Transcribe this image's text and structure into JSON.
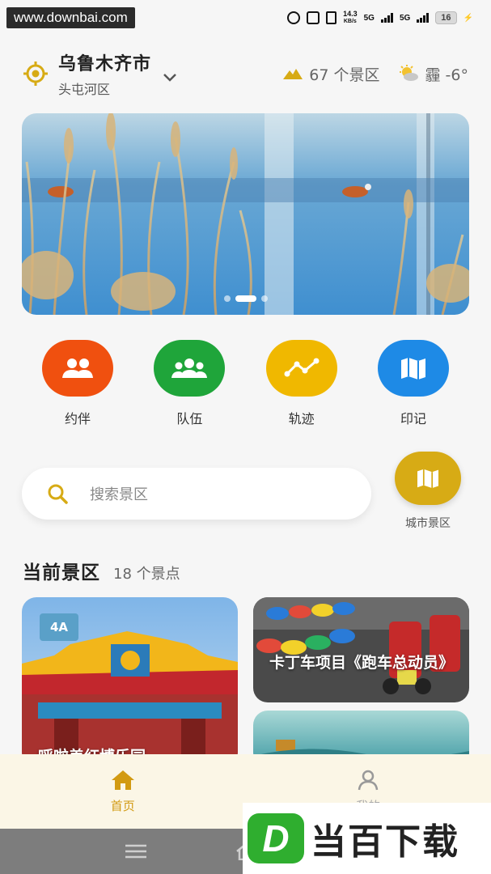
{
  "status_bar": {
    "watermark": "www.downbai.com",
    "net_speed_value": "14.3",
    "net_speed_unit": "KB/s",
    "signal1": "5G",
    "signal2": "5G",
    "battery": "16"
  },
  "header": {
    "city": "乌鲁木齐市",
    "district": "头屯河区",
    "scenic_count": "67 个景区",
    "weather": "霾 -6°"
  },
  "banner": {
    "slide_count": 3,
    "active_slide": 1
  },
  "actions": [
    {
      "label": "约伴",
      "color": "#f0500f"
    },
    {
      "label": "队伍",
      "color": "#1fa53a"
    },
    {
      "label": "轨迹",
      "color": "#f0b800"
    },
    {
      "label": "印记",
      "color": "#1e8ae6"
    }
  ],
  "search": {
    "placeholder": "搜索景区"
  },
  "city_spot": {
    "label": "城市景区"
  },
  "section": {
    "title": "当前景区",
    "count": "18 个景点"
  },
  "cards": [
    {
      "badge": "4A",
      "title": "呼啦盖红博乐园"
    },
    {
      "title": "卡丁车项目《跑车总动员》"
    },
    {
      "title": ""
    }
  ],
  "bottom_nav": {
    "home": "首页",
    "mine": "我的"
  },
  "watermark_bottom": {
    "logo_letter": "D",
    "text": "当百下载"
  },
  "colors": {
    "accent": "#d7ab15",
    "nav_active": "#d29a12"
  }
}
